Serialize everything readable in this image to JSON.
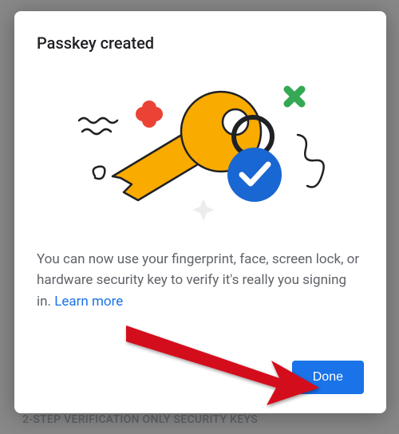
{
  "dialog": {
    "title": "Passkey created",
    "body": "You can now use your fingerprint, face, screen lock, or hardware security key to verify it's really you signing in. ",
    "learn_more": "Learn more",
    "done_label": "Done"
  },
  "backdrop": {
    "security_keys_label": "2-STEP VERIFICATION ONLY SECURITY KEYS"
  },
  "colors": {
    "primary": "#1a73e8",
    "key": "#f9ab00",
    "check_bg": "#1967d2",
    "accent_green": "#34a853",
    "accent_red": "#ea4335"
  }
}
